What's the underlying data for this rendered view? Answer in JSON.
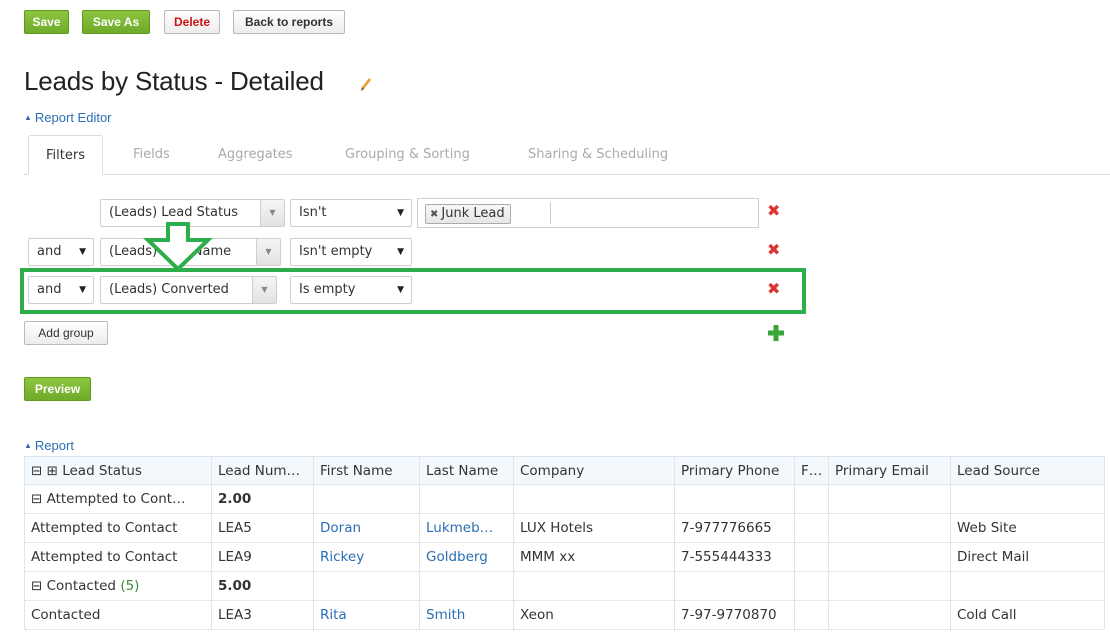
{
  "toolbar": {
    "save": "Save",
    "save_as": "Save As",
    "delete": "Delete",
    "back": "Back to reports"
  },
  "page_title": "Leads by Status - Detailed",
  "report_editor_link": "Report Editor",
  "tabs": [
    "Filters",
    "Fields",
    "Aggregates",
    "Grouping & Sorting",
    "Sharing & Scheduling"
  ],
  "filters": [
    {
      "connector": "",
      "field": "(Leads) Lead Status",
      "operator": "Isn't",
      "values": [
        "Junk Lead"
      ]
    },
    {
      "connector": "and",
      "field": "(Leads) First Name",
      "operator": "Isn't empty",
      "values": []
    },
    {
      "connector": "and",
      "field": "(Leads) Converted",
      "operator": "Is empty",
      "values": []
    }
  ],
  "add_group": "Add group",
  "preview": "Preview",
  "report_link": "Report",
  "table": {
    "headers": [
      "⊟ ⊞ Lead Status",
      "Lead Num…",
      "First Name",
      "Last Name",
      "Company",
      "Primary Phone",
      "F…",
      "Primary Email",
      "Lead Source"
    ],
    "group_attempted": "⊟ Attempted to Cont…",
    "group_attempted_value": "2.00",
    "group_contacted_label": "⊟ Contacted",
    "group_contacted_count": "(5)",
    "group_contacted_value": "5.00",
    "rows": [
      [
        "Attempted to Contact",
        "LEA5",
        "Doran",
        "Lukmeb…",
        "LUX Hotels",
        "7-977776665",
        "",
        "",
        "Web Site"
      ],
      [
        "Attempted to Contact",
        "LEA9",
        "Rickey",
        "Goldberg",
        "MMM xx",
        "7-555444333",
        "",
        "",
        "Direct Mail"
      ],
      [
        "Contacted",
        "LEA3",
        "Rita",
        "Smith",
        "Xeon",
        "7-97-9770870",
        "",
        "",
        "Cold Call"
      ]
    ]
  },
  "colors": {
    "accent_green": "#6faa2a",
    "link_blue": "#2a6eb3",
    "delete_red": "#dd3333",
    "highlight_green": "#2eae4a"
  }
}
